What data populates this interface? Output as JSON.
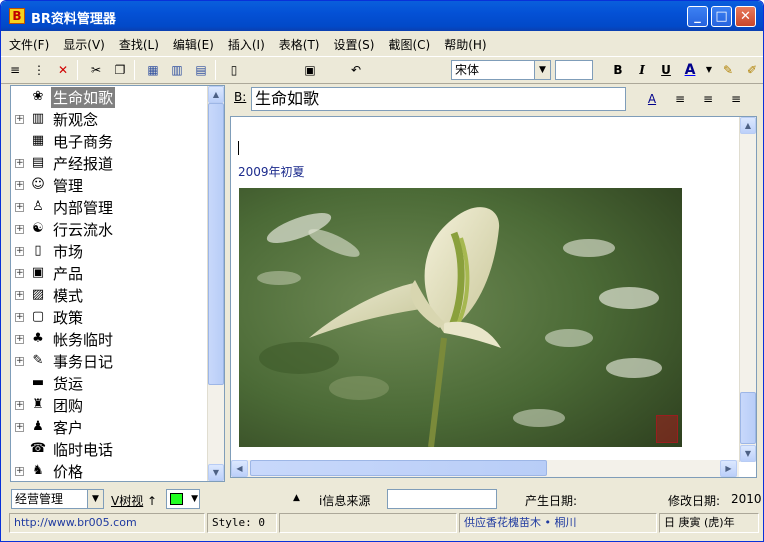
{
  "window": {
    "title": "BR资料管理器",
    "app_icon": "B"
  },
  "menu": [
    "文件(F)",
    "显示(V)",
    "查找(L)",
    "编辑(E)",
    "插入(I)",
    "表格(T)",
    "设置(S)",
    "截图(C)",
    "帮助(H)"
  ],
  "toolbar": {
    "font_name": "宋体",
    "font_size": "",
    "bold_label": "B",
    "italic_label": "I",
    "underline_label": "U",
    "fontcolor_label": "A"
  },
  "tree": {
    "items": [
      {
        "label": "生命如歌",
        "icon": "flower-icon",
        "glyph": "❀",
        "expander": false,
        "selected": true
      },
      {
        "label": "新观念",
        "icon": "column-icon",
        "glyph": "▥",
        "expander": true
      },
      {
        "label": "电子商务",
        "icon": "network-icon",
        "glyph": "▦",
        "expander": false
      },
      {
        "label": "产经报道",
        "icon": "news-icon",
        "glyph": "▤",
        "expander": true
      },
      {
        "label": "管理",
        "icon": "people-icon",
        "glyph": "☺",
        "expander": true
      },
      {
        "label": "内部管理",
        "icon": "person-icon",
        "glyph": "♙",
        "expander": true
      },
      {
        "label": "行云流水",
        "icon": "yinyang-icon",
        "glyph": "☯",
        "expander": true
      },
      {
        "label": "市场",
        "icon": "phone-icon",
        "glyph": "▯",
        "expander": true
      },
      {
        "label": "产品",
        "icon": "box-icon",
        "glyph": "▣",
        "expander": true
      },
      {
        "label": "模式",
        "icon": "chart-icon",
        "glyph": "▨",
        "expander": true
      },
      {
        "label": "政策",
        "icon": "book-icon",
        "glyph": "▢",
        "expander": true
      },
      {
        "label": "帐务临时",
        "icon": "flask-icon",
        "glyph": "♣",
        "expander": true
      },
      {
        "label": "事务日记",
        "icon": "notepad-icon",
        "glyph": "✎",
        "expander": true
      },
      {
        "label": "货运",
        "icon": "truck-icon",
        "glyph": "▬",
        "expander": false
      },
      {
        "label": "团购",
        "icon": "bag-icon",
        "glyph": "♜",
        "expander": true
      },
      {
        "label": "客户",
        "icon": "users-icon",
        "glyph": "♟",
        "expander": true
      },
      {
        "label": "临时电话",
        "icon": "telephone-icon",
        "glyph": "☎",
        "expander": false
      },
      {
        "label": "价格",
        "icon": "tag-icon",
        "glyph": "♞",
        "expander": true
      }
    ]
  },
  "editor": {
    "title_prefix": "B:",
    "title_value": "生命如歌",
    "date_text": "2009年初夏"
  },
  "bottom": {
    "category_value": "经营管理",
    "tree_view_label": "V树视",
    "up_arrow": "↑",
    "color_value": "#22ff22",
    "info_source_label": "i信息来源",
    "info_source_value": "",
    "created_label": "产生日期:",
    "modified_label": "修改日期:",
    "modified_value": "2010"
  },
  "status": {
    "url": "http://www.br005.com",
    "style": "Style: 0",
    "empty": "",
    "ad": "供应香花槐苗木 • 桐川",
    "lunar": "日 庚寅 (虎)年"
  }
}
